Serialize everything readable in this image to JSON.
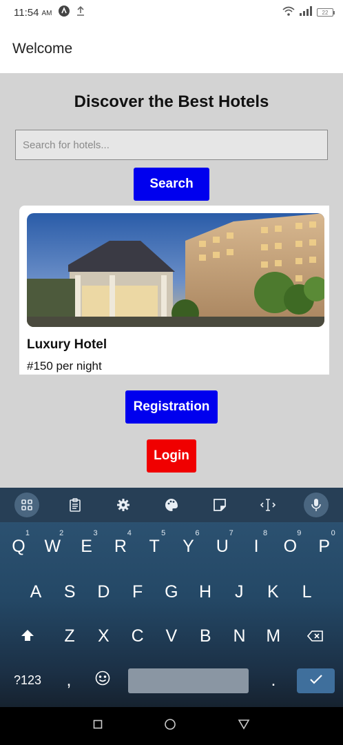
{
  "status_bar": {
    "time": "11:54",
    "ampm": "AM",
    "battery": "22",
    "icons": [
      "app-notification-icon",
      "upload-icon",
      "wifi-icon",
      "signal-icon",
      "battery-icon"
    ]
  },
  "header": {
    "title": "Welcome"
  },
  "main": {
    "title": "Discover the Best Hotels",
    "search_placeholder": "Search for hotels...",
    "search_button": "Search",
    "hotel": {
      "name": "Luxury Hotel",
      "price": "#150 per night"
    },
    "registration_button": "Registration",
    "login_button": "Login",
    "colors": {
      "primary_button": "#0000ee",
      "login_button": "#f00000",
      "background": "#d3d3d3"
    }
  },
  "keyboard": {
    "toolbar": [
      "apps-grid-icon",
      "clipboard-icon",
      "settings-gear-icon",
      "theme-palette-icon",
      "sticker-icon",
      "cursor-control-icon",
      "microphone-icon"
    ],
    "row1": [
      {
        "k": "Q",
        "n": "1"
      },
      {
        "k": "W",
        "n": "2"
      },
      {
        "k": "E",
        "n": "3"
      },
      {
        "k": "R",
        "n": "4"
      },
      {
        "k": "T",
        "n": "5"
      },
      {
        "k": "Y",
        "n": "6"
      },
      {
        "k": "U",
        "n": "7"
      },
      {
        "k": "I",
        "n": "8"
      },
      {
        "k": "O",
        "n": "9"
      },
      {
        "k": "P",
        "n": "0"
      }
    ],
    "row2": [
      "A",
      "S",
      "D",
      "F",
      "G",
      "H",
      "J",
      "K",
      "L"
    ],
    "row3": [
      "Z",
      "X",
      "C",
      "V",
      "B",
      "N",
      "M"
    ],
    "symbols_key": "?123",
    "comma_key": ",",
    "period_key": "."
  },
  "nav_bar": {
    "icons": [
      "recent-apps-icon",
      "home-icon",
      "back-icon"
    ]
  }
}
